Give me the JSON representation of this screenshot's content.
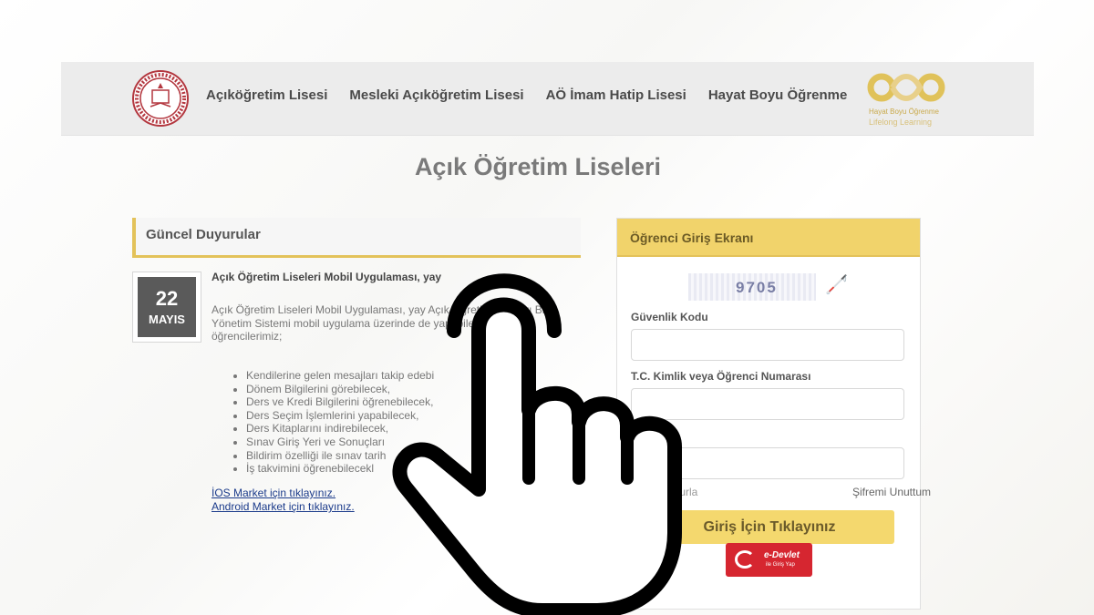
{
  "nav": {
    "links": [
      "Açıköğretim Lisesi",
      "Mesleki Açıköğretim Lisesi",
      "AÖ İmam Hatip Lisesi",
      "Hayat Boyu Öğrenme"
    ],
    "partner_logo_text_1": "Hayat Boyu Öğrenme",
    "partner_logo_text_2": "Lifelong Learning"
  },
  "page_title": "Açık Öğretim Liseleri",
  "announcements": {
    "header": "Güncel Duyurular",
    "date_day": "22",
    "date_month": "MAYIS",
    "title": "Açık Öğretim Liseleri Mobil Uygulaması, yay",
    "body": "Açık Öğretim Liseleri Mobil Uygulaması, yay Açık Öğretim Okulları Bilgi Yönetim Sistemi mobil uygulama üzerinde de yapabilecekle öğrencilerimiz;",
    "items": [
      "Kendilerine gelen mesajları takip edebi",
      "Dönem Bilgilerini görebilecek,",
      "Ders ve Kredi Bilgilerini öğrenebilecek,",
      "Ders Seçim İşlemlerini yapabilecek,",
      "Ders Kitaplarını indirebilecek,",
      "Sınav Giriş Yeri ve Sonuçları",
      "Bildirim özelliği ile sınav tarih",
      "İş takvimini öğrenebilecekl"
    ],
    "ios_link": "İOS Market için tıklayınız.",
    "android_link": "Android Market için tıklayınız."
  },
  "login": {
    "header": "Öğrenci Giriş Ekranı",
    "captcha": "9705",
    "captcha_icon": "accessibility-icon",
    "security_code_label": "Güvenlik Kodu",
    "id_label": "T.C. Kimlik veya Öğrenci Numarası",
    "remember_partial": "turla",
    "forgot_password": "Şifremi Unuttum",
    "submit": "Giriş İçin Tıklayınız",
    "edevlet_1": "e-Devlet",
    "edevlet_2": "ile Giriş Yap"
  },
  "overlay_icon": "pointing-hand-icon",
  "colors": {
    "accent": "#e3c25a",
    "button": "#f4d86e",
    "edevlet": "#d62630"
  }
}
